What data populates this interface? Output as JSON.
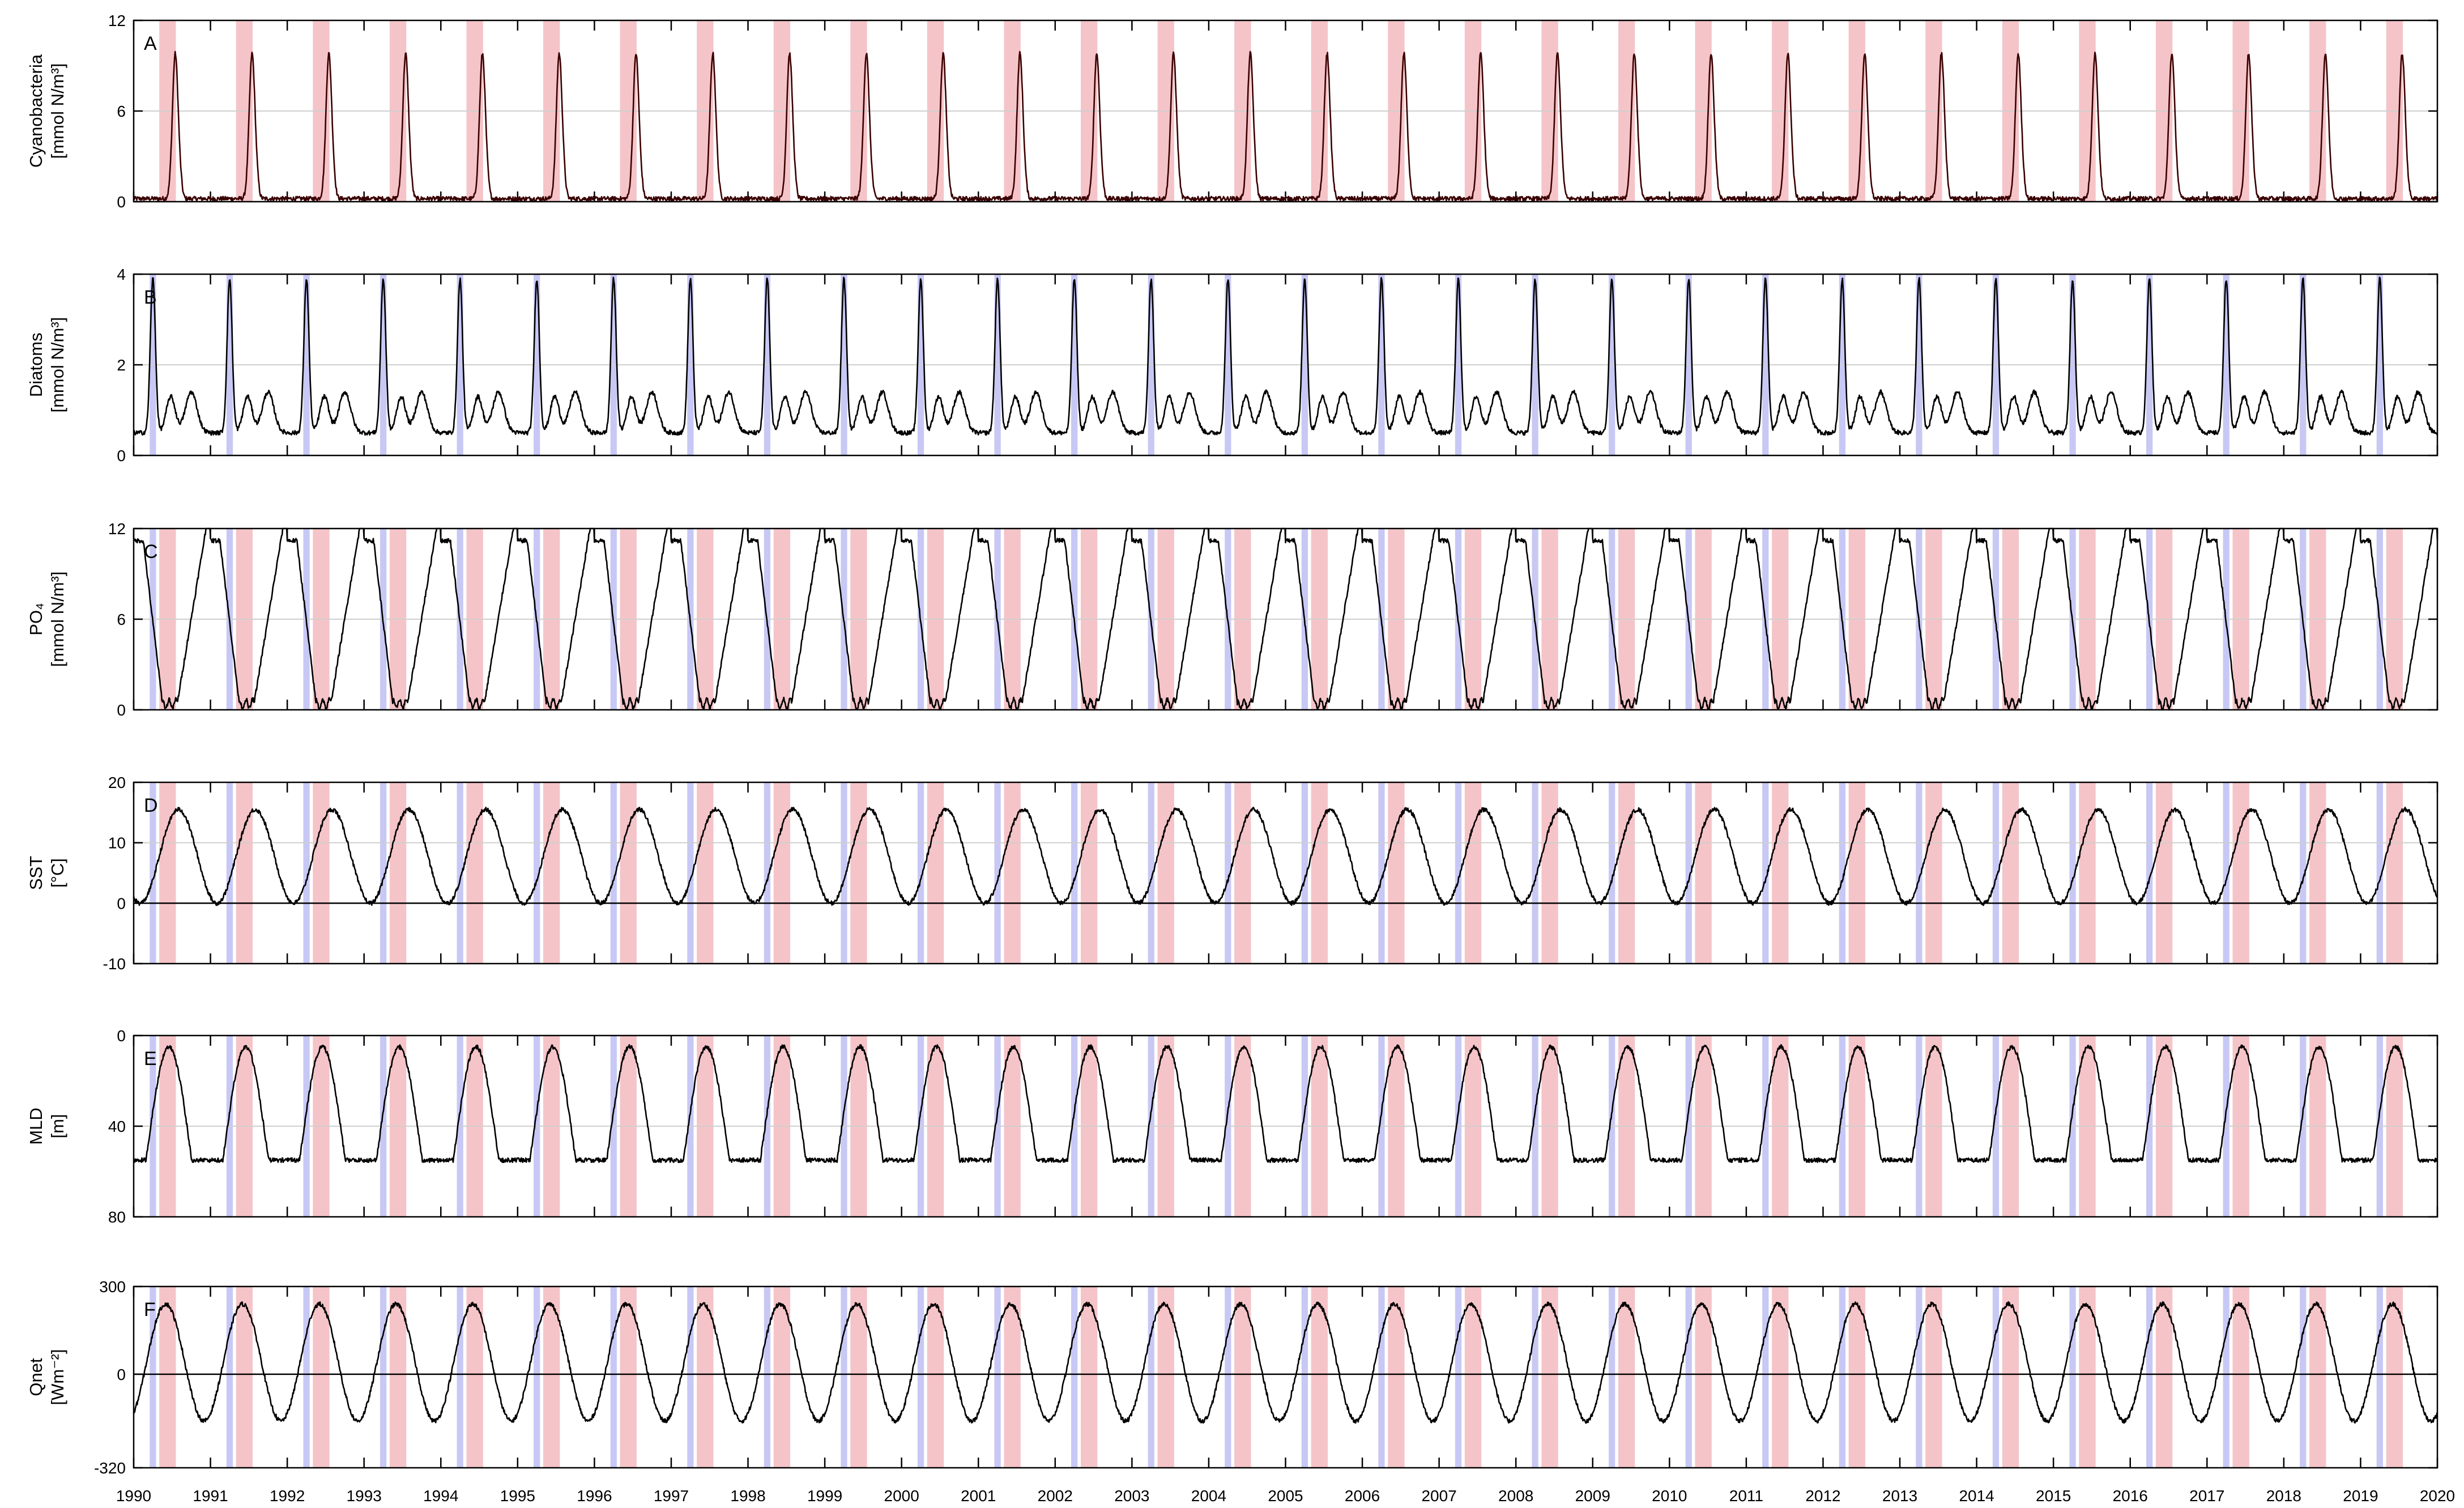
{
  "chart_data": [
    {
      "type": "line",
      "panel_letter": "A",
      "ylabel_lines": [
        "Cyanobacteria",
        "[mmol N/m³]"
      ],
      "ylim": [
        0,
        12
      ],
      "yticks": [
        0,
        6,
        12
      ],
      "y_inverted": false,
      "zero_line": false,
      "shading": [
        "pink"
      ],
      "seasonal_cycle": {
        "min": 0.2,
        "max": 9.8,
        "peak_month": 7.5,
        "shape": "narrow_bloom"
      },
      "grid": true
    },
    {
      "type": "line",
      "panel_letter": "B",
      "ylabel_lines": [
        "Diatoms",
        "[mmol N/m³]"
      ],
      "ylim": [
        0,
        4
      ],
      "yticks": [
        0,
        2,
        4
      ],
      "y_inverted": false,
      "zero_line": false,
      "shading": [
        "blue"
      ],
      "seasonal_cycle": {
        "min": 0.5,
        "max": 3.9,
        "peak_month": 4.0,
        "secondary_peaks": [
          1.3,
          1.4
        ],
        "shape": "spring_bloom"
      },
      "grid": true
    },
    {
      "type": "line",
      "panel_letter": "C",
      "ylabel_lines": [
        "PO₄",
        "[mmol N/m³]"
      ],
      "ylim": [
        0,
        12
      ],
      "yticks": [
        0,
        6,
        12
      ],
      "y_inverted": false,
      "zero_line": false,
      "shading": [
        "blue",
        "pink"
      ],
      "seasonal_cycle": {
        "min": 0.4,
        "max": 11.2,
        "drawdown_months": [
          3.5,
          6.0
        ],
        "shape": "nutrient_drawdown"
      },
      "grid": true
    },
    {
      "type": "line",
      "panel_letter": "D",
      "ylabel_lines": [
        "SST",
        "[°C]"
      ],
      "ylim": [
        -10,
        20
      ],
      "yticks": [
        -10,
        0,
        10,
        20
      ],
      "y_inverted": false,
      "zero_line": true,
      "shading": [
        "blue",
        "pink"
      ],
      "seasonal_cycle": {
        "min": 0,
        "max": 15.5,
        "peak_month": 8.0,
        "shape": "sinusoid"
      },
      "grid": true
    },
    {
      "type": "line",
      "panel_letter": "E",
      "ylabel_lines": [
        "MLD",
        "[m]"
      ],
      "ylim": [
        0,
        80
      ],
      "yticks": [
        0,
        40,
        80
      ],
      "y_inverted": true,
      "zero_line": false,
      "shading": [
        "blue",
        "pink"
      ],
      "seasonal_cycle": {
        "min": 5,
        "max": 55,
        "shallowest_month": 6.5,
        "shape": "mixed_layer"
      },
      "grid": true
    },
    {
      "type": "line",
      "panel_letter": "F",
      "ylabel_lines": [
        "Qnet",
        "[Wm⁻²]"
      ],
      "ylim": [
        -320,
        300
      ],
      "yticks": [
        -320,
        0,
        300
      ],
      "y_inverted": false,
      "zero_line": true,
      "shading": [
        "blue",
        "pink"
      ],
      "seasonal_cycle": {
        "min": -160,
        "max": 240,
        "peak_month": 6.0,
        "shape": "sinusoid"
      },
      "grid": true
    }
  ],
  "x_axis": {
    "xlim": [
      1990,
      2020
    ],
    "ticks": [
      "1990",
      "1991",
      "1992",
      "1993",
      "1994",
      "1995",
      "1996",
      "1997",
      "1998",
      "1999",
      "2000",
      "2001",
      "2002",
      "2003",
      "2004",
      "2005",
      "2006",
      "2007",
      "2008",
      "2009",
      "2010",
      "2011",
      "2012",
      "2013",
      "2014",
      "2015",
      "2016",
      "2017",
      "2018",
      "2019",
      "2020"
    ]
  },
  "seasonal_bands": {
    "blue": {
      "color": "#c8c8f5",
      "start_month": 3.5,
      "end_month": 4.5
    },
    "pink": {
      "color": "#f5c4c8",
      "start_month": 5.0,
      "end_month": 7.6
    }
  },
  "colors": {
    "line": "#000000",
    "bloom_line": "#3a0000",
    "grid": "#cfcfcf"
  }
}
